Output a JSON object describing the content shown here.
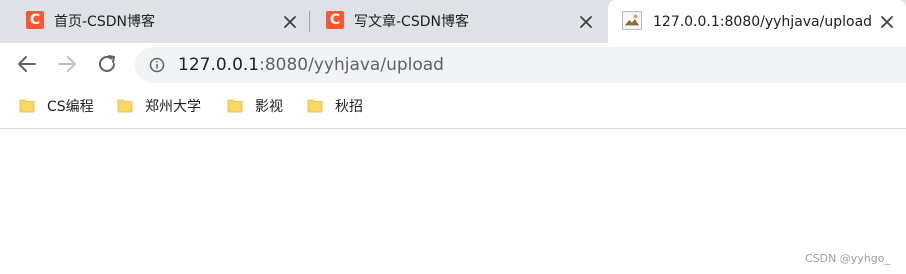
{
  "tabs": [
    {
      "title": "首页-CSDN博客",
      "favicon": "csdn-logo-icon",
      "favicon_glyph": "C",
      "active": false
    },
    {
      "title": "写文章-CSDN博客",
      "favicon": "csdn-logo-icon",
      "favicon_glyph": "C",
      "active": false
    },
    {
      "title": "127.0.0.1:8080/yyhjava/upload",
      "favicon": "broken-image-icon",
      "active": true
    }
  ],
  "address_bar": {
    "host": "127.0.0.1",
    "rest": ":8080/yyhjava/upload"
  },
  "bookmarks": [
    {
      "label": "CS编程",
      "icon": "folder-icon"
    },
    {
      "label": "郑州大学",
      "icon": "folder-icon"
    },
    {
      "label": "影视",
      "icon": "folder-icon"
    },
    {
      "label": "秋招",
      "icon": "folder-icon"
    }
  ],
  "watermark": "CSDN @yyhgo_",
  "colors": {
    "tabstrip": "#dee1e6",
    "csdn_brand": "#fc5531",
    "folder": "#fdd663",
    "omnibox": "#f1f3f4"
  }
}
